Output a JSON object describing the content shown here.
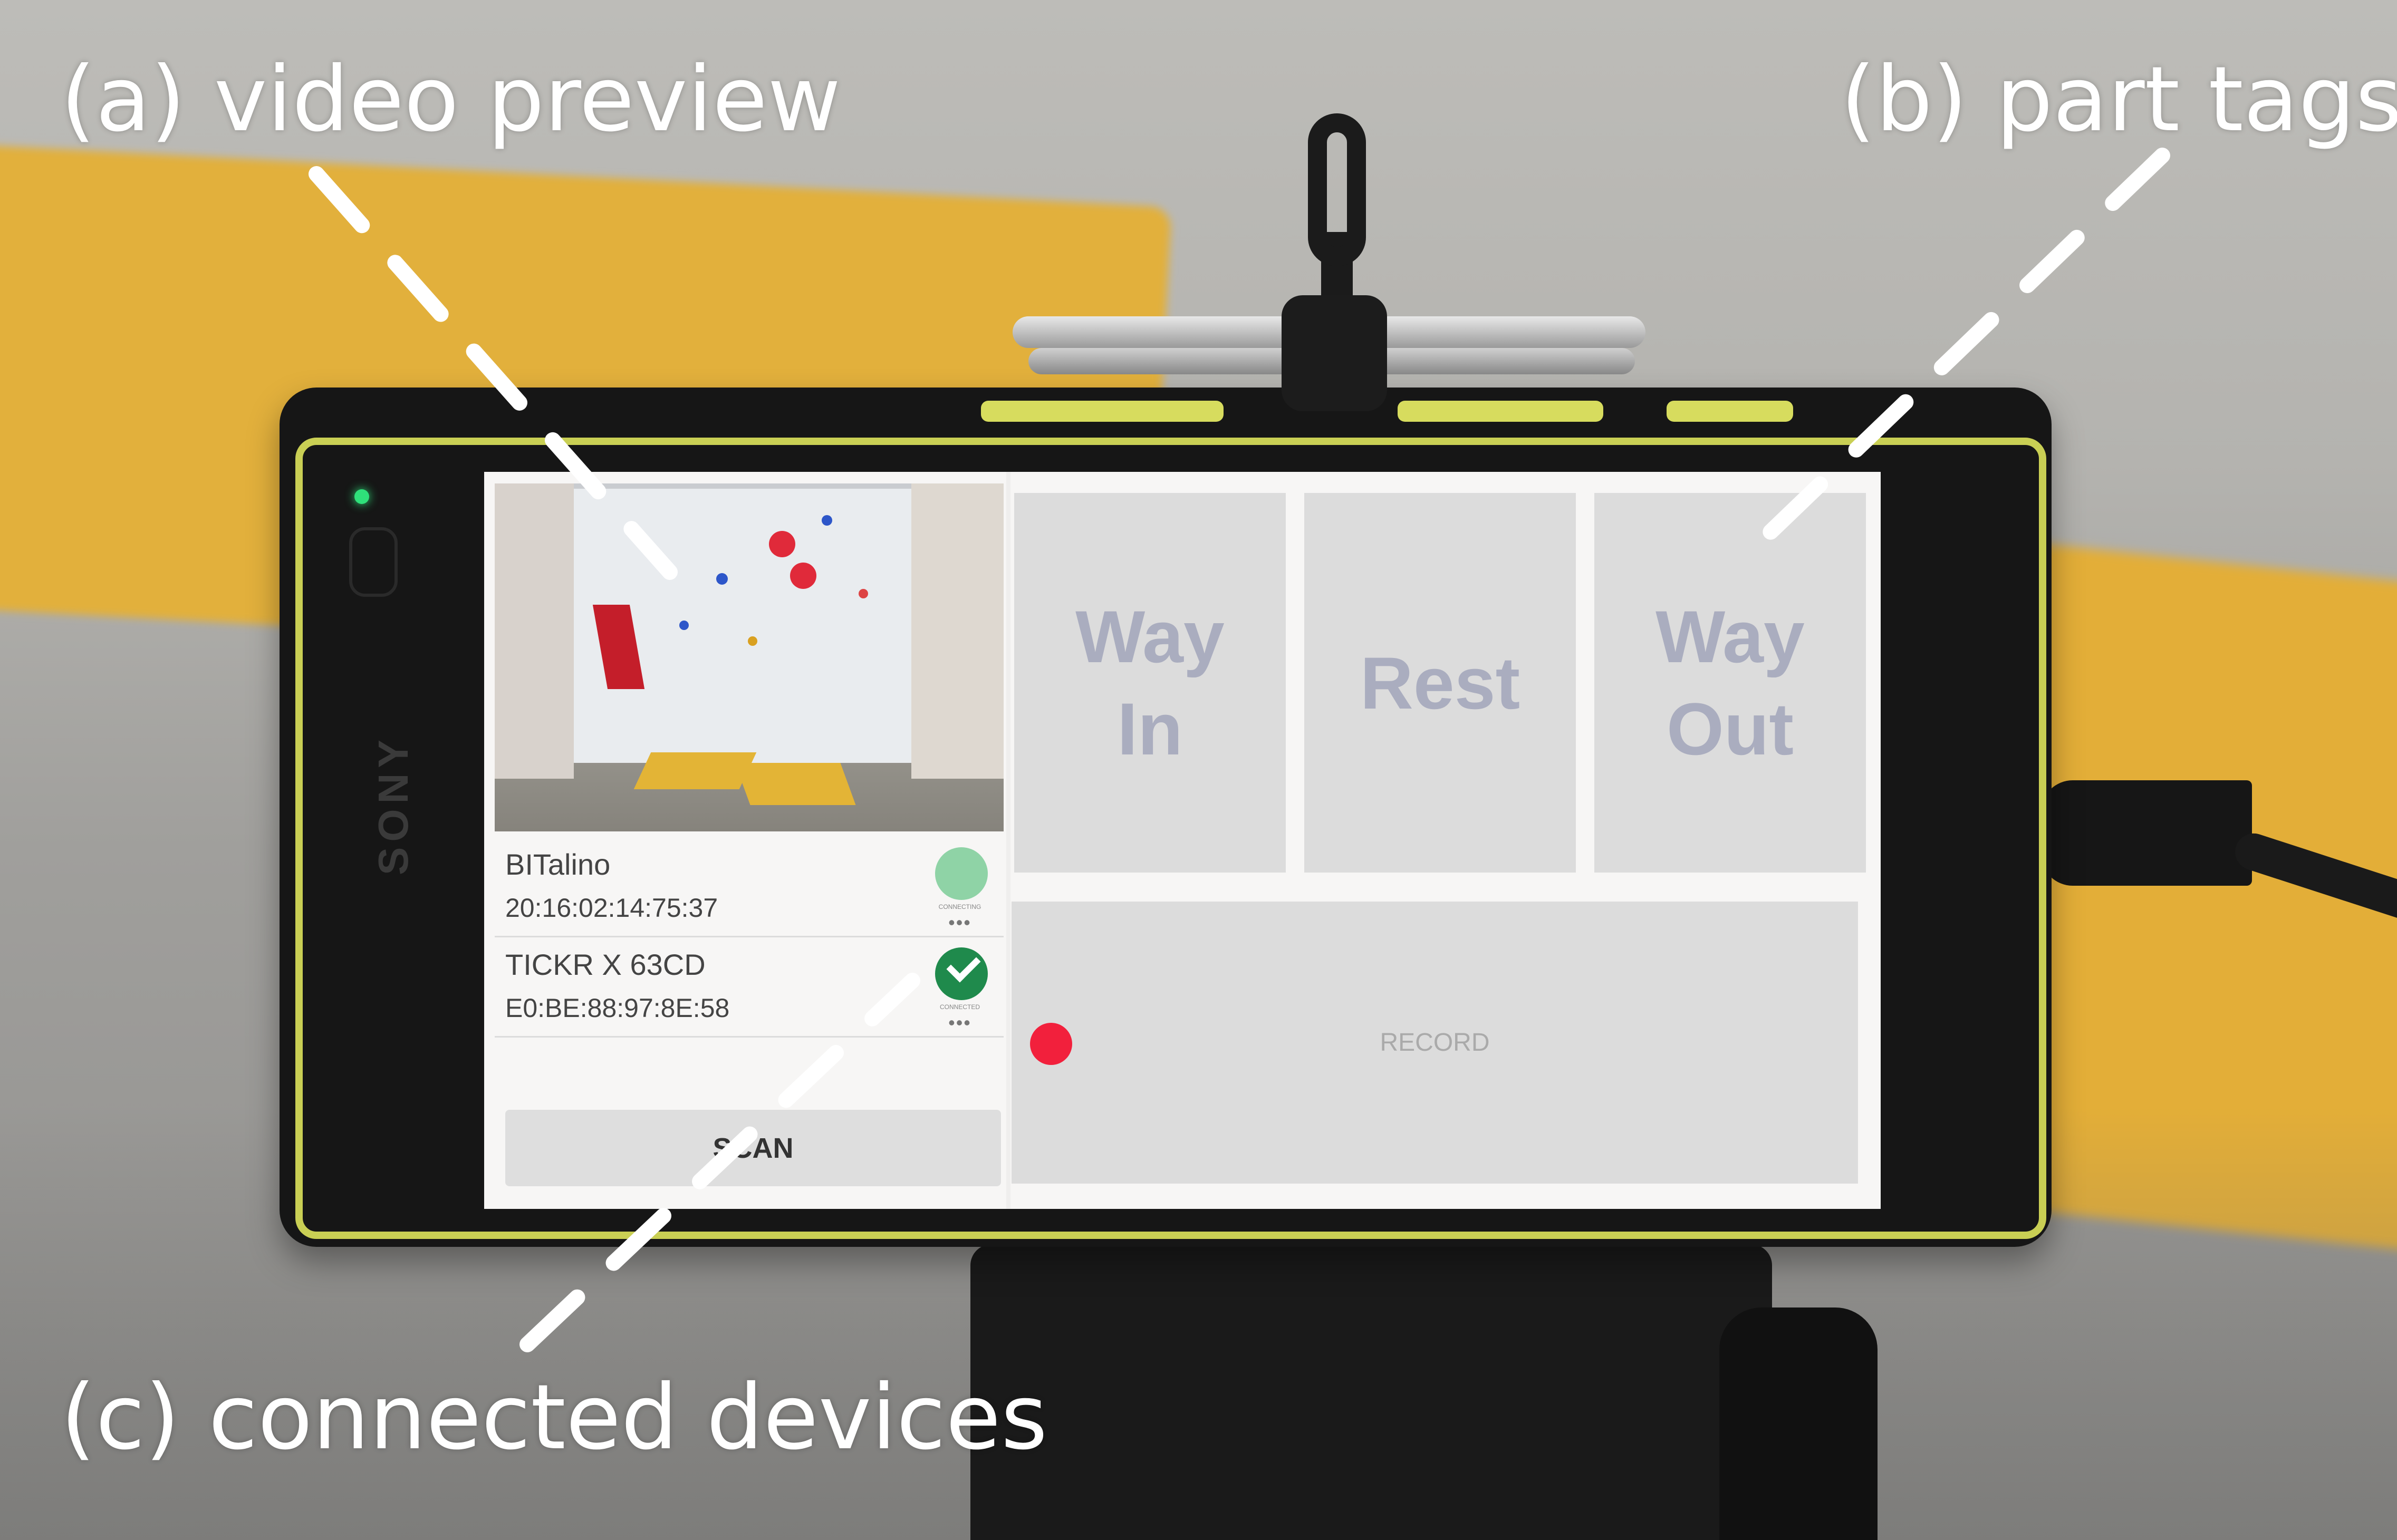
{
  "annotations": {
    "video_preview": "(a) video preview",
    "part_tags": "(b) part tags",
    "connected_devices": "(c) connected devices"
  },
  "phone": {
    "brand": "SONY"
  },
  "devices": [
    {
      "name": "BITalino",
      "address": "20:16:02:14:75:37",
      "status": "CONNECTING",
      "status_color": "#8fd3a6",
      "more": "•••"
    },
    {
      "name": "TICKR X 63CD",
      "address": "E0:BE:88:97:8E:58",
      "status": "CONNECTED",
      "status_color": "#1f8a4c",
      "more": "•••"
    }
  ],
  "scan_button": {
    "label": "SCAN"
  },
  "tags": [
    {
      "label_line1": "Way",
      "label_line2": "In"
    },
    {
      "label_line1": "Rest",
      "label_line2": ""
    },
    {
      "label_line1": "Way",
      "label_line2": "Out"
    }
  ],
  "record_button": {
    "label": "RECORD",
    "dot_color": "#f2203c"
  },
  "icons": {
    "status_connecting": "circle-icon",
    "status_connected": "check-circle-icon",
    "record": "record-dot-icon"
  }
}
